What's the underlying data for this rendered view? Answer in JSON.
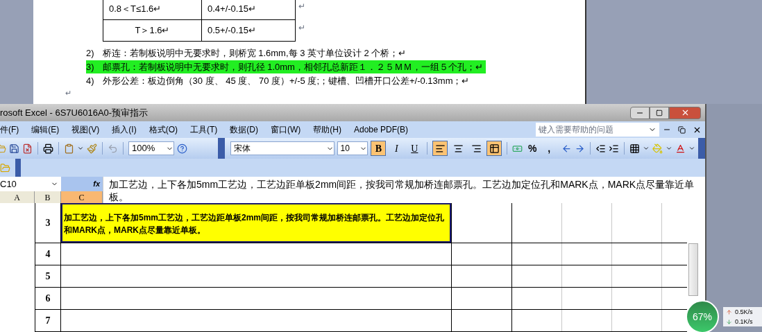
{
  "word_document": {
    "table_rows": [
      {
        "cells": [
          "0.8＜T≤1.6↵",
          "0.4+/-0.15↵"
        ],
        "row_end": "↵"
      },
      {
        "cells": [
          "T＞1.6↵",
          "0.5+/-0.15↵"
        ],
        "row_end": "↵"
      }
    ],
    "list_items": [
      {
        "number": "2)",
        "text": "桥连：若制板说明中无要求时，则桥宽 1.6mm,每 3 英寸单位设计 2 个桥；↵",
        "highlighted": false
      },
      {
        "number": "3)",
        "text": "邮票孔：若制板说明中无要求时，则孔径 1.0mm，相邻孔总新距１．２５ＭＭ，一组５个孔；↵",
        "highlighted": true
      },
      {
        "number": "4)",
        "text": "外形公差：板边倒角（30 度、 45 度、 70 度）+/-5 度;；键槽、凹槽开口公差+/-0.13mm；↵",
        "highlighted": false
      }
    ],
    "blank_paragraph": "↵"
  },
  "excel": {
    "title": "rosoft Excel - 6S7U6016A0-预审指示",
    "menu": [
      "件(F)",
      "编辑(E)",
      "视图(V)",
      "插入(I)",
      "格式(O)",
      "工具(T)",
      "数据(D)",
      "窗口(W)",
      "帮助(H)",
      "Adobe PDF(B)"
    ],
    "help_search": {
      "placeholder": "键入需要帮助的问题"
    },
    "toolbar": {
      "zoom": "100%",
      "font": "宋体",
      "font_size": "10",
      "format_buttons": [
        {
          "label": "B",
          "selected": true
        },
        {
          "label": "I",
          "selected": false
        },
        {
          "label": "U",
          "selected": false
        }
      ],
      "align_buttons": [
        {
          "kind": "left",
          "selected": true
        },
        {
          "kind": "center",
          "selected": false
        },
        {
          "kind": "right",
          "selected": false
        },
        {
          "kind": "merge",
          "selected": true
        }
      ],
      "number_buttons": [
        "%",
        ","
      ]
    },
    "name_box": "C10",
    "formula_label": "fx",
    "formula": "加工艺边，上下各加5mm工艺边，工艺边距单板2mm间距，按我司常规加桥连邮票孔。工艺边加定位孔和MARK点，MARK点尽量靠近单板。",
    "columns": [
      {
        "label": "A",
        "selected": false
      },
      {
        "label": "B",
        "selected": false
      },
      {
        "label": "C",
        "selected": true
      }
    ],
    "rows": [
      {
        "number": "3",
        "text": "加工艺边，上下各加5mm工艺边，工艺边距单板2mm间距，按我司常规加桥连邮票孔。工艺边加定位孔和MARK点，MARK点尽量靠近单板。"
      },
      {
        "number": "4"
      },
      {
        "number": "5"
      },
      {
        "number": "6"
      },
      {
        "number": "7"
      }
    ]
  },
  "network_widget": {
    "percent": "67%",
    "upload": "0.5K/s",
    "download": "0.1K/s"
  }
}
